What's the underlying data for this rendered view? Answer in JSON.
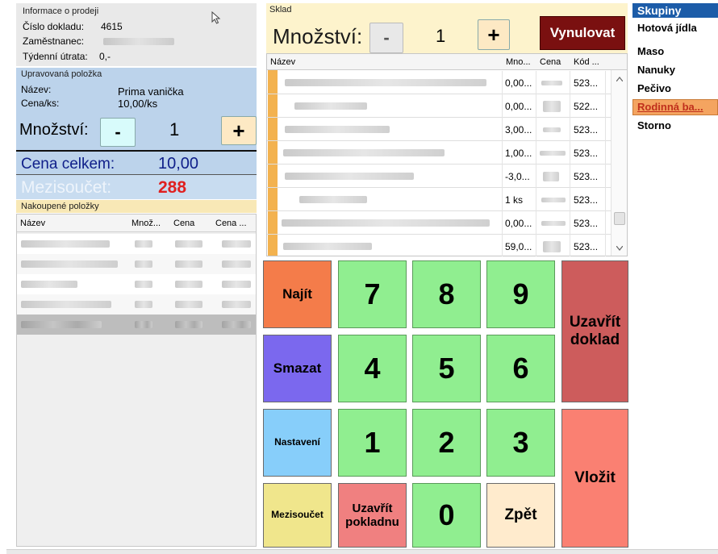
{
  "info": {
    "header": "Informace o prodeji",
    "doc_label": "Číslo dokladu:",
    "doc_value": "4615",
    "employee_label": "Zaměstnanec:",
    "weekly_label": "Týdenní útrata:",
    "weekly_value": "0,-"
  },
  "edited": {
    "header": "Upravovaná položka",
    "name_label": "Název:",
    "name_value": "Prima vanička",
    "price_label": "Cena/ks:",
    "price_value": "10,00/ks",
    "qty_label": "Množství:",
    "qty_minus": "-",
    "qty_value": "1",
    "qty_plus": "+",
    "total_label": "Cena celkem:",
    "total_value": "10,00",
    "subtotal_label": "Mezisoučet:",
    "subtotal_value": "288"
  },
  "bought": {
    "header": "Nakoupené položky",
    "columns": [
      "Název",
      "Množ...",
      "Cena",
      "Cena ..."
    ]
  },
  "stock": {
    "header": "Sklad",
    "qty_label": "Množství:",
    "minus": "-",
    "qty_value": "1",
    "plus": "+",
    "reset": "Vynulovat",
    "columns": [
      "Název",
      "Mno...",
      "Cena",
      "Kód ..."
    ],
    "rows": [
      {
        "qty": "0,00...",
        "code": "523..."
      },
      {
        "qty": "0,00...",
        "code": "522..."
      },
      {
        "qty": "3,00...",
        "code": "523..."
      },
      {
        "qty": "1,00...",
        "code": "523..."
      },
      {
        "qty": "-3,0...",
        "code": "523..."
      },
      {
        "qty": "1 ks",
        "code": "523..."
      },
      {
        "qty": "0,00...",
        "code": "523..."
      },
      {
        "qty": "59,0...",
        "code": "523..."
      }
    ]
  },
  "keypad": {
    "find": "Najít",
    "delete": "Smazat",
    "settings": "Nastavení",
    "subtotal": "Mezisoučet",
    "close_register": "Uzavřít pokladnu",
    "back": "Zpět",
    "close_doc": "Uzavřít doklad",
    "insert": "Vložit",
    "digits": [
      "7",
      "8",
      "9",
      "4",
      "5",
      "6",
      "1",
      "2",
      "3",
      "0"
    ]
  },
  "groups": {
    "header": "Skupiny",
    "items": [
      "Hotová jídla",
      "Maso",
      "Nanuky",
      "Pečivo",
      "Rodinná ba...",
      "Storno"
    ]
  },
  "colors": {
    "reset_button": "#7a1010",
    "find": "#f47c4a",
    "delete": "#7b68ee",
    "settings": "#87cefa",
    "subtotal": "#f0e68c",
    "close_register": "#f08080",
    "back": "#ffebcd",
    "close_doc": "#cd5c5c",
    "insert": "#fa8072",
    "digit": "#90ee90",
    "subtotal_value": "#e02020",
    "selected_group": "#f4a460"
  }
}
